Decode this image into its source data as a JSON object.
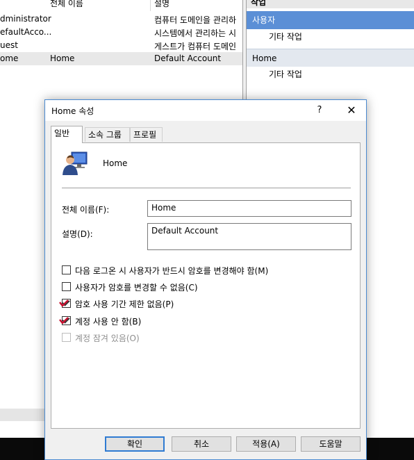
{
  "list": {
    "columns": [
      "전체 이름",
      "설명"
    ],
    "rows": [
      {
        "name": "dministrator",
        "full": "",
        "desc": "컴퓨터 도메인을 관리하"
      },
      {
        "name": "efaultAcco...",
        "full": "",
        "desc": "시스템에서 관리하는 시"
      },
      {
        "name": "uest",
        "full": "",
        "desc": "게스트가 컴퓨터 도메인"
      },
      {
        "name": "ome",
        "full": "Home",
        "desc": "Default Account"
      }
    ]
  },
  "actions": {
    "header": "작업",
    "sections": [
      {
        "title": "사용자",
        "item": "기타 작업"
      },
      {
        "title": "Home",
        "item": "기타 작업"
      }
    ]
  },
  "dialog": {
    "title": "Home 속성",
    "help": "?",
    "close": "✕",
    "tabs": [
      "일반",
      "소속 그룹",
      "프로필"
    ],
    "active_tab": "일반",
    "user_name": "Home",
    "full_name_label": "전체 이름(F):",
    "full_name_value": "Home",
    "desc_label": "설명(D):",
    "desc_value": "Default Account",
    "checkboxes": [
      {
        "label": "다음 로그온 시 사용자가 반드시 암호를 변경해야 함(M)",
        "checked": false,
        "enabled": true
      },
      {
        "label": "사용자가 암호를 변경할 수 없음(C)",
        "checked": false,
        "enabled": true
      },
      {
        "label": "암호 사용 기간 제한 없음(P)",
        "checked": true,
        "enabled": true
      },
      {
        "label": "계정 사용 안 함(B)",
        "checked": true,
        "enabled": true
      },
      {
        "label": "계정 잠겨 있음(O)",
        "checked": false,
        "enabled": false
      }
    ],
    "buttons": {
      "ok": "확인",
      "cancel": "취소",
      "apply": "적용(A)",
      "help": "도움말"
    }
  },
  "colors": {
    "accent": "#2f7bd2",
    "action_band": "#5b8fd6",
    "annotation": "#c8102e"
  }
}
